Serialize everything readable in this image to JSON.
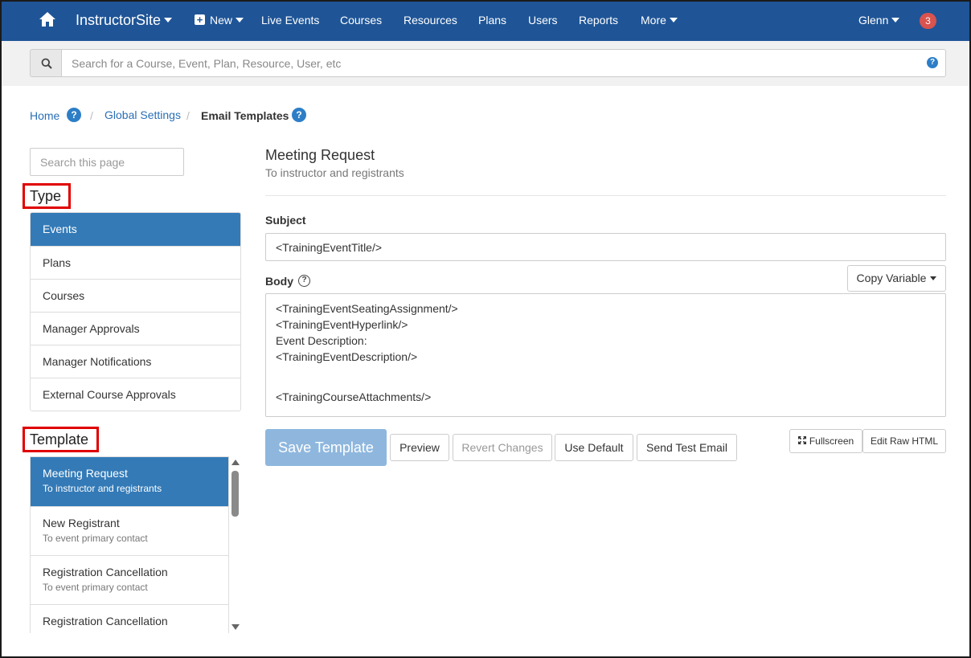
{
  "navbar": {
    "brand": "InstructorSite",
    "new_label": "New",
    "items": [
      "Live Events",
      "Courses",
      "Resources",
      "Plans",
      "Users",
      "Reports"
    ],
    "more_label": "More",
    "user": "Glenn",
    "notifications_count": "3",
    "colors": {
      "bar": "#1f5597",
      "badge": "#d9534f"
    }
  },
  "search": {
    "placeholder": "Search for a Course, Event, Plan, Resource, User, etc"
  },
  "breadcrumb": {
    "home": "Home",
    "global_settings": "Global Settings",
    "current": "Email Templates",
    "separator": "/"
  },
  "sidebar": {
    "search_placeholder": "Search this page",
    "type_heading": "Type",
    "types": [
      "Events",
      "Plans",
      "Courses",
      "Manager Approvals",
      "Manager Notifications",
      "External Course Approvals"
    ],
    "active_type": "Events",
    "template_heading": "Template",
    "templates": [
      {
        "title": "Meeting Request",
        "subtitle": "To instructor and registrants"
      },
      {
        "title": "New Registrant",
        "subtitle": "To event primary contact"
      },
      {
        "title": "Registration Cancellation",
        "subtitle": "To event primary contact"
      },
      {
        "title": "Registration Cancellation",
        "subtitle": ""
      }
    ]
  },
  "main": {
    "title": "Meeting Request",
    "subtitle": "To instructor and registrants",
    "subject_label": "Subject",
    "subject_value": "<TrainingEventTitle/>",
    "body_label": "Body",
    "copy_variable_label": "Copy Variable",
    "body_lines": [
      "<TrainingEventSeatingAssignment/>",
      "<TrainingEventHyperlink/>",
      "Event Description:",
      "<TrainingEventDescription/>",
      "",
      "<TrainingCourseAttachments/>"
    ],
    "buttons": {
      "save": "Save Template",
      "preview": "Preview",
      "revert": "Revert Changes",
      "use_default": "Use Default",
      "send_test": "Send Test Email",
      "fullscreen": "Fullscreen",
      "edit_raw": "Edit Raw HTML"
    }
  }
}
